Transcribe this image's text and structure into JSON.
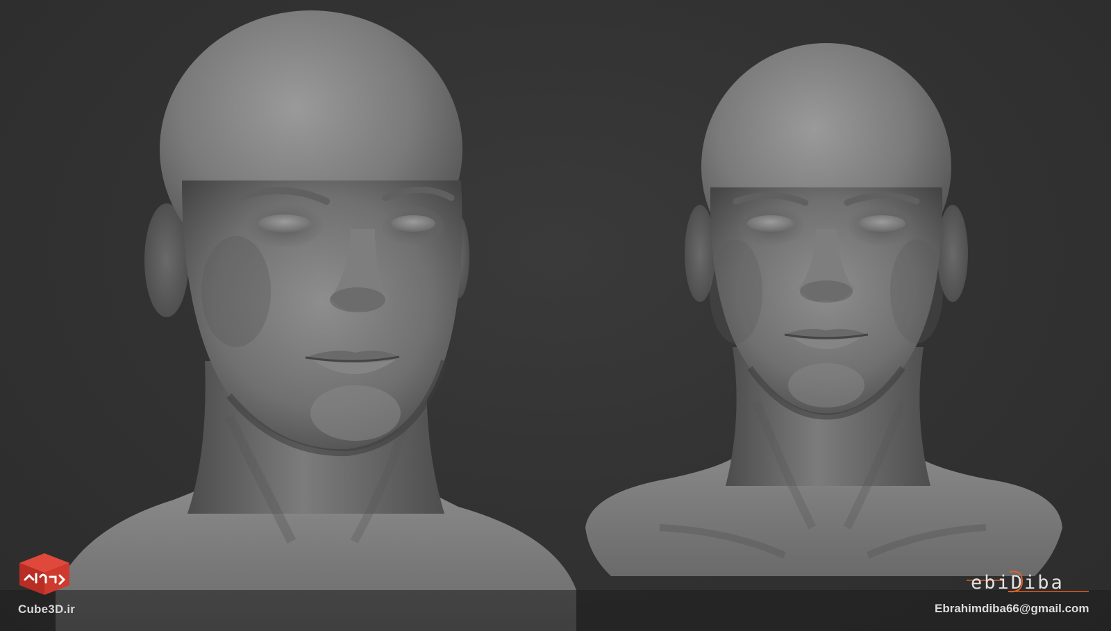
{
  "scene": {
    "background_color": "#333333",
    "clay_color": "#8c8c8c",
    "accent_color": "#e2622b",
    "subjects": [
      "sculpt-bust-three-quarter",
      "sculpt-bust-front"
    ]
  },
  "watermark": {
    "logo_icon": "cube-icon",
    "logo_text": "مکعب",
    "logo_color": "#d63b2f",
    "site": "Cube3D.ir"
  },
  "signature": {
    "text": "ebiDiba",
    "accent_color": "#e2622b"
  },
  "contact": {
    "email": "Ebrahimdiba66@gmail.com"
  }
}
